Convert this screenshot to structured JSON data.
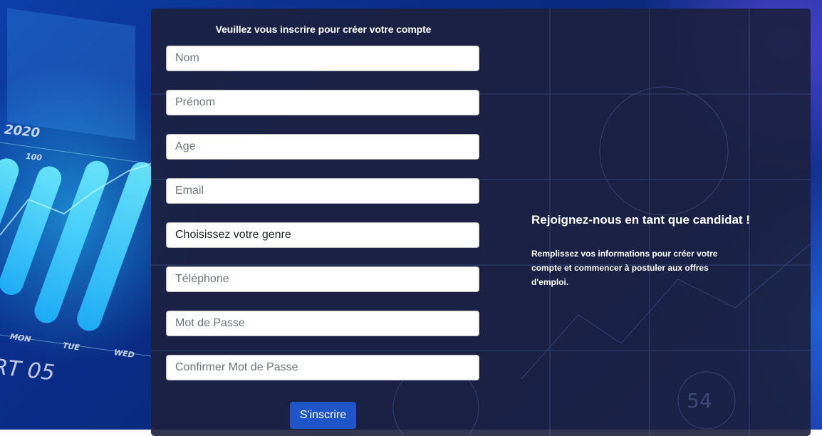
{
  "form": {
    "title": "Veuillez vous inscrire pour créer votre compte",
    "fields": {
      "nom": "Nom",
      "prenom": "Prénom",
      "age": "Age",
      "email": "Email",
      "genre": "Choisissez votre genre",
      "telephone": "Téléphone",
      "mot_de_passe": "Mot de Passe",
      "confirmer_mot_de_passe": "Confirmer Mot de Passe"
    },
    "submit_label": "S'inscrire"
  },
  "side": {
    "title": "Rejoignez-nous en tant que candidat !",
    "text": "Remplissez vos informations pour créer votre compte et commencer à postuler aux offres d'emploi."
  },
  "background": {
    "year": "2020",
    "tick": "100",
    "days": [
      "MON",
      "TUE",
      "WED"
    ],
    "report": "RT 05",
    "gauge": "54"
  },
  "colors": {
    "button": "#1f55c8",
    "panel": "#1c203e",
    "accent_cyan": "#3fd8ff"
  }
}
